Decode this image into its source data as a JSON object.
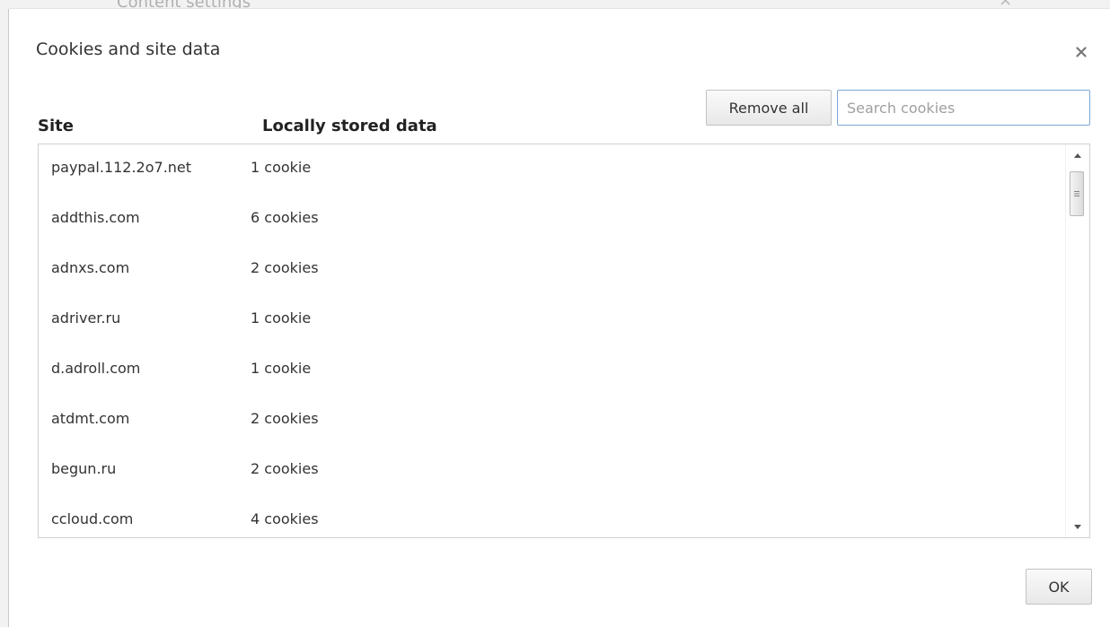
{
  "background_page": {
    "title": "Content settings"
  },
  "dialog": {
    "title": "Cookies and site data",
    "close_icon": "close-icon"
  },
  "toolbar": {
    "remove_all_label": "Remove all",
    "search_placeholder": "Search cookies",
    "search_value": ""
  },
  "table": {
    "columns": [
      "Site",
      "Locally stored data"
    ],
    "rows": [
      {
        "site": "paypal.112.2o7.net",
        "data": "1 cookie"
      },
      {
        "site": "addthis.com",
        "data": "6 cookies"
      },
      {
        "site": "adnxs.com",
        "data": "2 cookies"
      },
      {
        "site": "adriver.ru",
        "data": "1 cookie"
      },
      {
        "site": "d.adroll.com",
        "data": "1 cookie"
      },
      {
        "site": "atdmt.com",
        "data": "2 cookies"
      },
      {
        "site": "begun.ru",
        "data": "2 cookies"
      },
      {
        "site": "ccloud.com",
        "data": "4 cookies"
      }
    ]
  },
  "footer": {
    "ok_label": "OK"
  },
  "colors": {
    "search_border": "#7ca6d8",
    "text": "#333333"
  }
}
